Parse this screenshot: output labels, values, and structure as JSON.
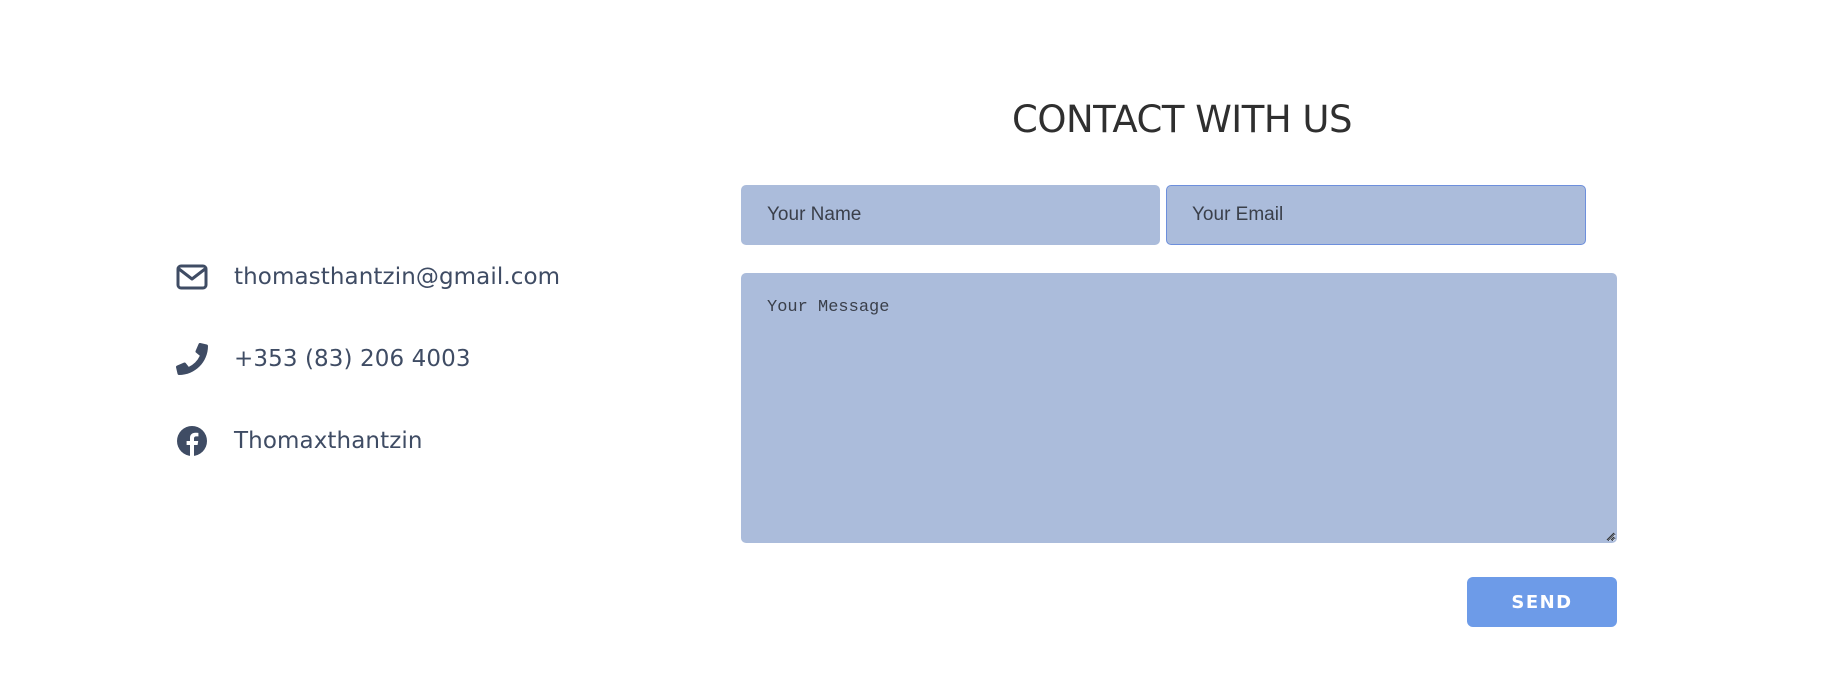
{
  "contact_info": {
    "items": [
      {
        "icon": "envelope-icon",
        "text": "thomasthantzin@gmail.com"
      },
      {
        "icon": "phone-icon",
        "text": "+353 (83) 206 4003"
      },
      {
        "icon": "facebook-icon",
        "text": "Thomaxthantzin"
      }
    ]
  },
  "form": {
    "title": "CONTACT WITH US",
    "name_placeholder": "Your Name",
    "email_placeholder": "Your Email",
    "message_placeholder": "Your Message",
    "send_label": "SEND"
  },
  "colors": {
    "field_background": "#abbcdb",
    "accent": "#6d9be8",
    "icon": "#3f4c64",
    "title": "#2f2f2f"
  }
}
